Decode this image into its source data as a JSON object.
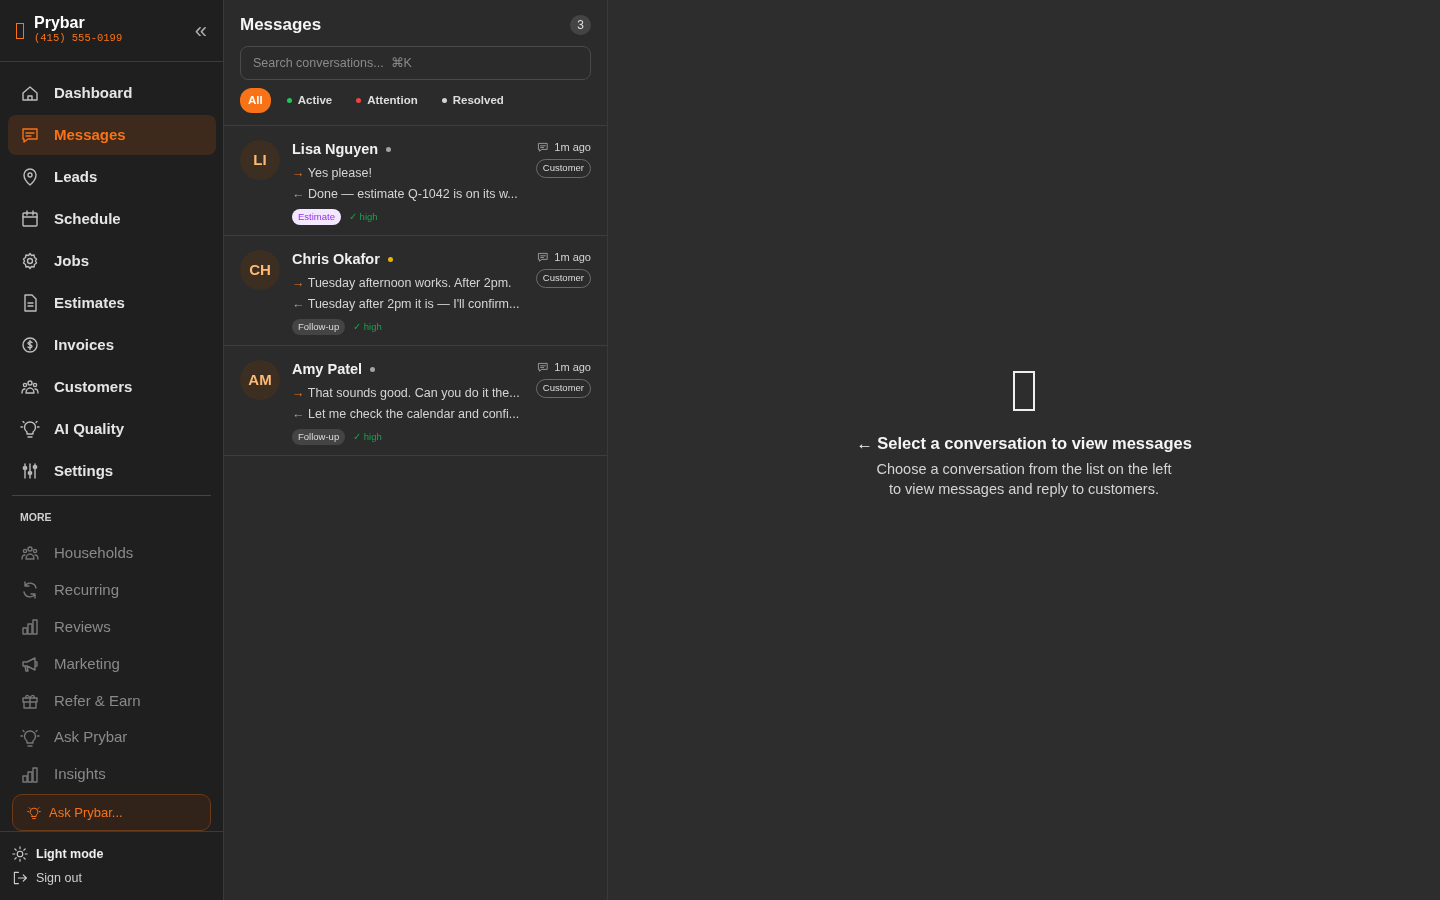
{
  "brand": {
    "name": "Prybar",
    "phone": "(415) 555-0199",
    "collapse": "«"
  },
  "nav": [
    {
      "label": "Dashboard",
      "selected": false
    },
    {
      "label": "Messages",
      "selected": true
    },
    {
      "label": "Leads",
      "selected": false
    },
    {
      "label": "Schedule",
      "selected": false
    },
    {
      "label": "Jobs",
      "selected": false
    },
    {
      "label": "Estimates",
      "selected": false
    },
    {
      "label": "Invoices",
      "selected": false
    },
    {
      "label": "Customers",
      "selected": false
    },
    {
      "label": "AI Quality",
      "selected": false
    },
    {
      "label": "Settings",
      "selected": false
    }
  ],
  "more": {
    "heading": "MORE",
    "items": [
      {
        "label": "Households"
      },
      {
        "label": "Recurring"
      },
      {
        "label": "Reviews"
      },
      {
        "label": "Marketing"
      },
      {
        "label": "Refer & Earn"
      },
      {
        "label": "Ask Prybar"
      },
      {
        "label": "Insights"
      }
    ]
  },
  "ask_button": "Ask Prybar...",
  "footer": [
    {
      "label": "Light mode",
      "kind": "theme"
    },
    {
      "label": "Sign out",
      "kind": "signout"
    }
  ],
  "messages": {
    "title": "Messages",
    "count": "3",
    "search": {
      "placeholder": "Search conversations...  ⌘K"
    },
    "filters": [
      {
        "label": "All",
        "selected": true
      },
      {
        "label": "Active",
        "selected": false,
        "color": "#22c55e"
      },
      {
        "label": "Attention",
        "selected": false,
        "color": "#ef4444"
      },
      {
        "label": "Resolved",
        "selected": false,
        "color": "#d4d4d4"
      }
    ],
    "conversations": [
      {
        "initials": "LI",
        "name": "Lisa Nguyen",
        "color": "#a3a3a3",
        "time": "1m ago",
        "tag": "Customer",
        "lines": [
          {
            "kind": "incoming",
            "mark": "→",
            "text": "Yes please!"
          },
          {
            "kind": "outgoing",
            "mark": "←",
            "text": "Done — estimate Q-1042 is on its w..."
          }
        ],
        "label": {
          "kind": "estimate",
          "text": "Estimate"
        },
        "priority": "✓ high"
      },
      {
        "initials": "CH",
        "name": "Chris Okafor",
        "color": "#eab308",
        "time": "1m ago",
        "tag": "Customer",
        "lines": [
          {
            "kind": "incoming",
            "mark": "→",
            "text": "Tuesday afternoon works. After 2pm."
          },
          {
            "kind": "outgoing",
            "mark": "←",
            "text": "Tuesday after 2pm it is — I'll confirm..."
          }
        ],
        "label": {
          "kind": "followup",
          "text": "Follow-up"
        },
        "priority": "✓ high"
      },
      {
        "initials": "AM",
        "name": "Amy Patel",
        "color": "#a3a3a3",
        "time": "1m ago",
        "tag": "Customer",
        "lines": [
          {
            "kind": "incoming",
            "mark": "→",
            "text": "That sounds good. Can you do it the..."
          },
          {
            "kind": "outgoing",
            "mark": "←",
            "text": "Let me check the calendar and confi..."
          }
        ],
        "label": {
          "kind": "followup",
          "text": "Follow-up"
        },
        "priority": "✓ high"
      }
    ]
  },
  "empty_state": {
    "title": "← Select a conversation to view messages",
    "body": "Choose a conversation from the list on the left\nto view messages and reply to customers."
  }
}
